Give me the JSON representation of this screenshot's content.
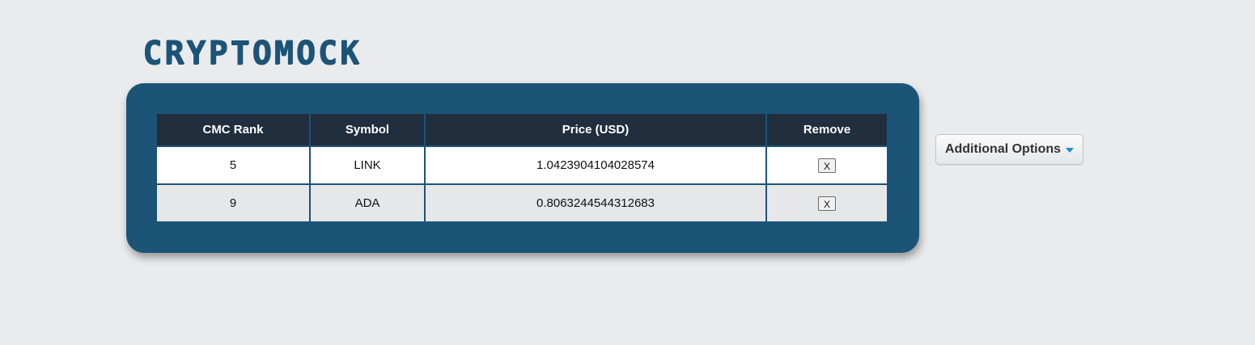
{
  "app": {
    "logo": "CRYPTOMOCK"
  },
  "table": {
    "headers": [
      "CMC Rank",
      "Symbol",
      "Price (USD)",
      "Remove"
    ],
    "rows": [
      {
        "rank": "5",
        "symbol": "LINK",
        "price": "1.0423904104028574",
        "remove_label": "X"
      },
      {
        "rank": "9",
        "symbol": "ADA",
        "price": "0.8063244544312683",
        "remove_label": "X"
      }
    ]
  },
  "options": {
    "label": "Additional Options",
    "caret_icon": "caret-down-icon"
  },
  "colors": {
    "background": "#eaebed",
    "panel": "#1c5478",
    "header": "#202e3d",
    "accent": "#1a8fc7"
  }
}
